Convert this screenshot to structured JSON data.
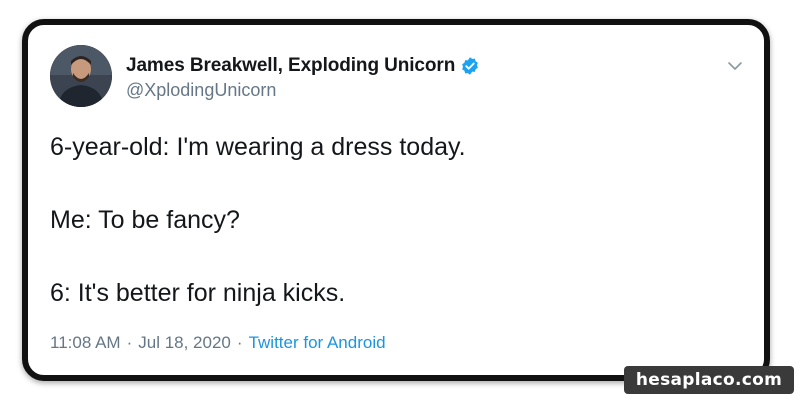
{
  "tweet": {
    "author": {
      "display_name": "James Breakwell, Exploding Unicorn",
      "handle": "@XplodingUnicorn",
      "verified": true
    },
    "lines": [
      "6-year-old: I'm wearing a dress today.",
      "Me: To be fancy?",
      "6: It's better for ninja kicks."
    ],
    "time": "11:08 AM",
    "separator": "·",
    "date": "Jul 18, 2020",
    "source": "Twitter for Android"
  },
  "watermark": {
    "text": "hesaplaco.com"
  },
  "colors": {
    "text": "#14171a",
    "secondary": "#657786",
    "link": "#1b95e0",
    "verified": "#1da1f2",
    "border": "#111111"
  },
  "icons": {
    "verified": "verified-badge-icon",
    "menu": "chevron-down-icon"
  }
}
